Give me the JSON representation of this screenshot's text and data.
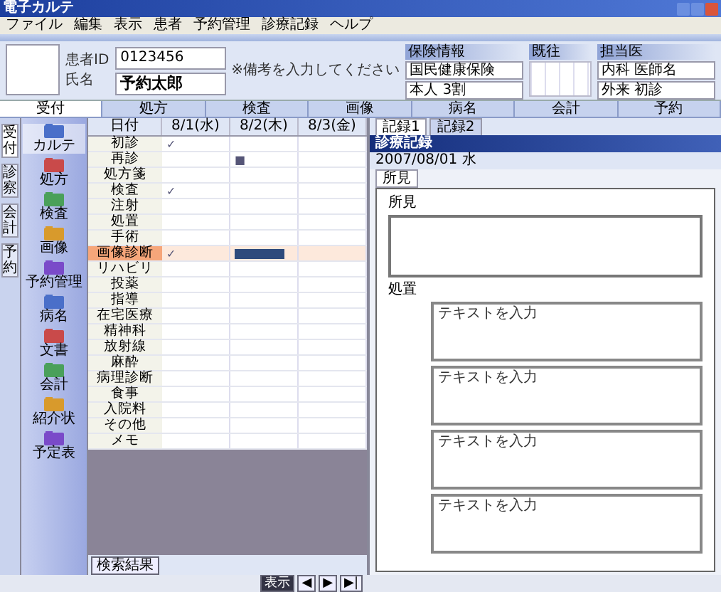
{
  "window": {
    "title": "電子カルテ"
  },
  "menu": [
    "ファイル",
    "編集",
    "表示",
    "患者",
    "予約管理",
    "診療記録",
    "ヘルプ"
  ],
  "patient": {
    "id_label": "患者ID",
    "id_value": "0123456",
    "name_label": "氏名",
    "name_value": "予約太郎",
    "note": "※備考を入力してください"
  },
  "insurance": {
    "title": "保険情報",
    "lines": [
      "国民健康保険",
      "本人 3割"
    ]
  },
  "history": {
    "title": "既往"
  },
  "doctor": {
    "title": "担当医",
    "lines": [
      "内科 医師名",
      "外来 初診"
    ]
  },
  "main_tabs": [
    {
      "label": "受付",
      "selected": true
    },
    {
      "label": "処方",
      "selected": false
    },
    {
      "label": "検査",
      "selected": false
    },
    {
      "label": "画像",
      "selected": false
    },
    {
      "label": "病名",
      "selected": false
    },
    {
      "label": "会計",
      "selected": false
    },
    {
      "label": "予約",
      "selected": false
    }
  ],
  "side_strip": [
    {
      "label": "受付",
      "selected": true
    },
    {
      "label": "診察",
      "selected": false
    },
    {
      "label": "会計",
      "selected": false
    },
    {
      "label": "予約",
      "selected": false
    }
  ],
  "sidebar": [
    {
      "label": "カルテ",
      "selected": true
    },
    {
      "label": "処方",
      "selected": false
    },
    {
      "label": "検査",
      "selected": false
    },
    {
      "label": "画像",
      "selected": false
    },
    {
      "label": "予約管理",
      "selected": false
    },
    {
      "label": "病名",
      "selected": false
    },
    {
      "label": "文書",
      "selected": false
    },
    {
      "label": "会計",
      "selected": false
    },
    {
      "label": "紹介状",
      "selected": false
    },
    {
      "label": "予定表",
      "selected": false
    }
  ],
  "grid": {
    "corner": "日付",
    "columns": [
      "8/1(水)",
      "8/2(木)",
      "8/3(金)"
    ],
    "rows": [
      {
        "label": "初診",
        "selected": false,
        "cells": [
          {
            "kind": "text",
            "text": "✓"
          },
          {
            "kind": "empty"
          },
          {
            "kind": "empty"
          }
        ]
      },
      {
        "label": "再診",
        "selected": false,
        "cells": [
          {
            "kind": "empty"
          },
          {
            "kind": "text",
            "text": "■"
          },
          {
            "kind": "empty"
          }
        ]
      },
      {
        "label": "処方箋",
        "selected": false,
        "cells": [
          {
            "kind": "empty"
          },
          {
            "kind": "empty"
          },
          {
            "kind": "empty"
          }
        ]
      },
      {
        "label": "検査",
        "selected": false,
        "cells": [
          {
            "kind": "text",
            "text": "✓"
          },
          {
            "kind": "empty"
          },
          {
            "kind": "empty"
          }
        ]
      },
      {
        "label": "注射",
        "selected": false,
        "cells": [
          {
            "kind": "empty"
          },
          {
            "kind": "empty"
          },
          {
            "kind": "empty"
          }
        ]
      },
      {
        "label": "処置",
        "selected": false,
        "cells": [
          {
            "kind": "empty"
          },
          {
            "kind": "empty"
          },
          {
            "kind": "empty"
          }
        ]
      },
      {
        "label": "手術",
        "selected": false,
        "cells": [
          {
            "kind": "empty"
          },
          {
            "kind": "empty"
          },
          {
            "kind": "empty"
          }
        ]
      },
      {
        "label": "画像診断",
        "selected": true,
        "cells": [
          {
            "kind": "text",
            "text": "✓"
          },
          {
            "kind": "bar"
          },
          {
            "kind": "empty"
          }
        ]
      },
      {
        "label": "リハビリ",
        "selected": false,
        "cells": [
          {
            "kind": "empty"
          },
          {
            "kind": "empty"
          },
          {
            "kind": "empty"
          }
        ]
      },
      {
        "label": "投薬",
        "selected": false,
        "cells": [
          {
            "kind": "empty"
          },
          {
            "kind": "empty"
          },
          {
            "kind": "empty"
          }
        ]
      },
      {
        "label": "指導",
        "selected": false,
        "cells": [
          {
            "kind": "empty"
          },
          {
            "kind": "empty"
          },
          {
            "kind": "empty"
          }
        ]
      },
      {
        "label": "在宅医療",
        "selected": false,
        "cells": [
          {
            "kind": "empty"
          },
          {
            "kind": "empty"
          },
          {
            "kind": "empty"
          }
        ]
      },
      {
        "label": "精神科",
        "selected": false,
        "cells": [
          {
            "kind": "empty"
          },
          {
            "kind": "empty"
          },
          {
            "kind": "empty"
          }
        ]
      },
      {
        "label": "放射線",
        "selected": false,
        "cells": [
          {
            "kind": "empty"
          },
          {
            "kind": "empty"
          },
          {
            "kind": "empty"
          }
        ]
      },
      {
        "label": "麻酔",
        "selected": false,
        "cells": [
          {
            "kind": "empty"
          },
          {
            "kind": "empty"
          },
          {
            "kind": "empty"
          }
        ]
      },
      {
        "label": "病理診断",
        "selected": false,
        "cells": [
          {
            "kind": "empty"
          },
          {
            "kind": "empty"
          },
          {
            "kind": "empty"
          }
        ]
      },
      {
        "label": "食事",
        "selected": false,
        "cells": [
          {
            "kind": "empty"
          },
          {
            "kind": "empty"
          },
          {
            "kind": "empty"
          }
        ]
      },
      {
        "label": "入院料",
        "selected": false,
        "cells": [
          {
            "kind": "empty"
          },
          {
            "kind": "empty"
          },
          {
            "kind": "empty"
          }
        ]
      },
      {
        "label": "その他",
        "selected": false,
        "cells": [
          {
            "kind": "empty"
          },
          {
            "kind": "empty"
          },
          {
            "kind": "empty"
          }
        ]
      },
      {
        "label": "メモ",
        "selected": false,
        "cells": [
          {
            "kind": "empty"
          },
          {
            "kind": "empty"
          },
          {
            "kind": "empty"
          }
        ]
      }
    ]
  },
  "grid_footer_button": "検索結果",
  "pager": [
    "表示",
    "◀",
    "▶",
    "▶|"
  ],
  "record": {
    "tabs": [
      {
        "label": "記録1",
        "selected": true
      },
      {
        "label": "記録2",
        "selected": false
      }
    ],
    "header": "診療記録",
    "date": "2007/08/01 水",
    "subtab": "所見",
    "findings_label": "所見",
    "treatment_label": "処置",
    "boxes": [
      "テキストを入力",
      "テキストを入力",
      "テキストを入力",
      "テキストを入力"
    ]
  }
}
